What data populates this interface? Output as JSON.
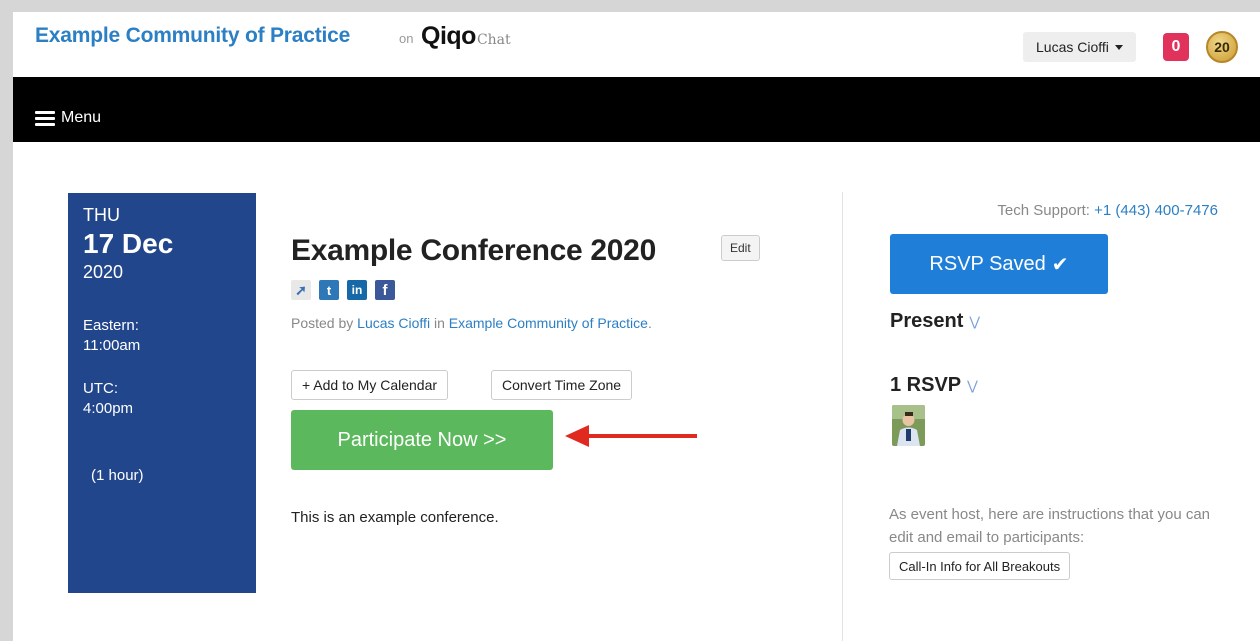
{
  "header": {
    "community_name": "Example Community of Practice",
    "on_text": "on",
    "brand_mark": "Qiqo",
    "brand_suffix": "Chat",
    "user_name": "Lucas Cioffi",
    "notification_count": "0",
    "points": "20"
  },
  "menubar": {
    "menu_label": "Menu"
  },
  "event_date": {
    "weekday": "THU",
    "date": "17 Dec",
    "year": "2020",
    "local_tz_label": "Eastern:",
    "local_time": "11:00am",
    "utc_label": "UTC:",
    "utc_time": "4:00pm",
    "duration": "(1 hour)"
  },
  "event": {
    "title": "Example Conference 2020",
    "edit_label": "Edit",
    "posted_prefix": "Posted by",
    "author": "Lucas Cioffi",
    "in_text": "in",
    "community": "Example Community of Practice",
    "add_calendar_label": "+ Add to My Calendar",
    "convert_tz_label": "Convert Time Zone",
    "participate_label": "Participate Now >>",
    "description": "This is an example conference."
  },
  "social_icons": [
    "share-icon",
    "tumblr-icon",
    "linkedin-icon",
    "facebook-icon"
  ],
  "sidebar": {
    "support_label": "Tech Support:",
    "support_phone": "+1 (443) 400-7476",
    "rsvp_label": "RSVP Saved",
    "rsvp_check": "✔",
    "present_heading": "Present",
    "rsvp_count_heading": "1 RSVP",
    "host_note": "As event host, here are instructions that you can edit and email to participants:",
    "callin_label": "Call-In Info for All Breakouts"
  },
  "colors": {
    "brand_blue": "#2b7fc4",
    "date_panel": "#22468c",
    "participate_green": "#5cb85c",
    "rsvp_blue": "#1f7fd8",
    "notif_red": "#e0325b",
    "arrow_red": "#e02a1f"
  }
}
